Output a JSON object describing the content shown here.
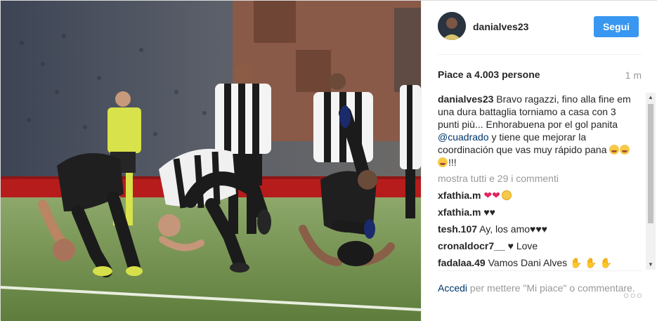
{
  "post": {
    "username": "danialves23",
    "follow_label": "Segui",
    "likes": "Piace a 4.003 persone",
    "time": "1 m",
    "caption": {
      "username": "danialves23",
      "text_before": " Bravo ragazzi, fino alla fine em una dura battaglia torniamo a casa con 3 punti più... Enhorabuena por el gol panita ",
      "mention": "@cuadrado",
      "text_after": " y tiene que mejorar la coordinación que vas muy rápido pana ",
      "text_end": "!!!"
    },
    "show_all_comments": "mostra tutti e 29 i commenti",
    "comments": [
      {
        "username": "xfathia.m",
        "text": "",
        "icon": "red-hearts-smile"
      },
      {
        "username": "xfathia.m",
        "text": "",
        "icon": "black-hearts"
      },
      {
        "username": "tesh.107",
        "text": "Ay, los amo",
        "icon": "black-hearts-3"
      },
      {
        "username": "cronaldocr7__",
        "text": "Love",
        "icon": "black-heart"
      },
      {
        "username": "fadalaa.49",
        "text": "Vamos Dani Alves",
        "icon": "clapping-hands"
      }
    ],
    "footer": {
      "login_label": "Accedi",
      "text": " per mettere \"Mi piace\" o commentare.",
      "more_label": "○○○"
    }
  },
  "colors": {
    "accent": "#3897f0",
    "link": "#003569",
    "muted": "#999999"
  }
}
